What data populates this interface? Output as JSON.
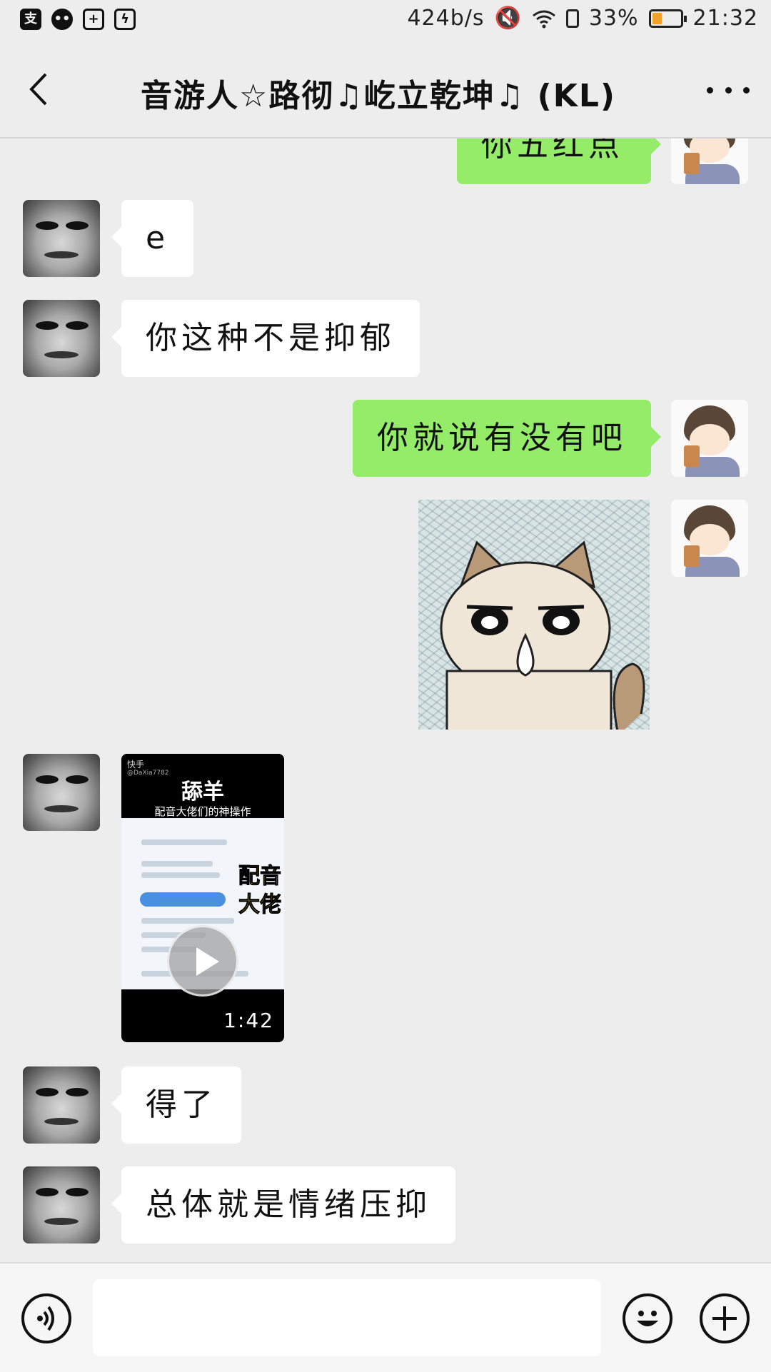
{
  "status_bar": {
    "left_icons": [
      "alipay-icon",
      "wechat-icon",
      "sim-plus-icon",
      "battery-saver-icon"
    ],
    "net_speed": "424b/s",
    "battery_percent": "33%",
    "battery_level": 0.33,
    "time": "21:32",
    "colors": {
      "battery_fill": "#f2a12a"
    }
  },
  "header": {
    "back_icon": "chevron-left-icon",
    "title": "音游人☆路彻♫屹立乾坤♫ (KL)",
    "more_icon": "more-dots-icon"
  },
  "messages": [
    {
      "type": "text",
      "direction": "out",
      "text": "你五红点"
    },
    {
      "type": "text",
      "direction": "in",
      "text": "e"
    },
    {
      "type": "text",
      "direction": "in",
      "text": "你这种不是抑郁"
    },
    {
      "type": "text",
      "direction": "out",
      "text": "你就说有没有吧"
    },
    {
      "type": "image",
      "direction": "out",
      "content": "cat-sticker"
    },
    {
      "type": "video",
      "direction": "in",
      "thumbnail": {
        "brand": "快手",
        "handle": "@DaXia7782",
        "title": "舔羊",
        "subtitle": "配音大佬们的神操作",
        "overlay": "配音大佬"
      },
      "duration": "1:42"
    },
    {
      "type": "text",
      "direction": "in",
      "text": "得了"
    },
    {
      "type": "text",
      "direction": "in",
      "text": "总体就是情绪压抑"
    }
  ],
  "input_bar": {
    "voice_icon": "voice-icon",
    "text_value": "",
    "emoji_icon": "emoji-icon",
    "plus_icon": "plus-icon"
  },
  "colors": {
    "background": "#ededed",
    "bubble_out": "#95ec69",
    "bubble_in": "#ffffff"
  }
}
